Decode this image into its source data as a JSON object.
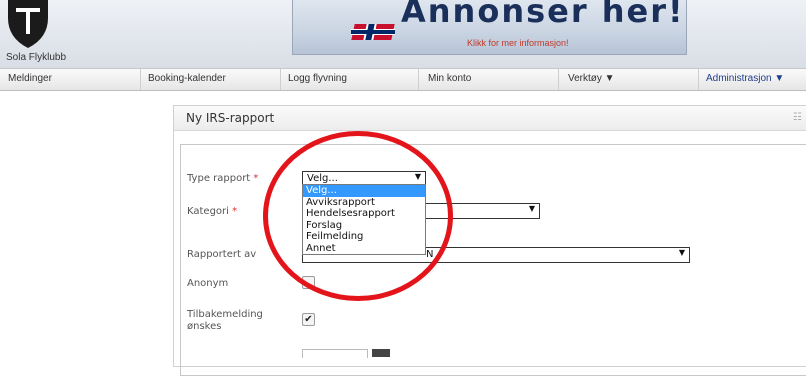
{
  "club": {
    "name": "Sola Flyklubb"
  },
  "banner": {
    "title": "Annonser her!",
    "subtitle": "Klikk for mer informasjon!"
  },
  "nav": {
    "items": [
      {
        "label": "Meldinger"
      },
      {
        "label": "Booking-kalender"
      },
      {
        "label": "Logg flyvning"
      },
      {
        "label": "Min konto"
      },
      {
        "label": "Verktøy ▼"
      },
      {
        "label": "Administrasjon ▼"
      }
    ]
  },
  "panel": {
    "title": "Ny IRS-rapport"
  },
  "form": {
    "type_label": "Type rapport",
    "required_mark": "*",
    "type_value": "Velg...",
    "category_label": "Kategori",
    "reported_by_label": "Rapportert av",
    "reported_by_value": "N",
    "anonymous_label": "Anonym",
    "feedback_label_line1": "Tilbakemelding",
    "feedback_label_line2": "ønskes",
    "feedback_checked": "✔",
    "dropdown_arrow": "▼"
  },
  "dropdown": {
    "options": [
      "Velg...",
      "Avviksrapport",
      "Hendelsesrapport",
      "Forslag",
      "Feilmelding",
      "Annet"
    ],
    "selected": "Velg..."
  },
  "colors": {
    "accent": "#3399ff",
    "highlight_circle": "#e3151b",
    "required": "#e03030"
  }
}
